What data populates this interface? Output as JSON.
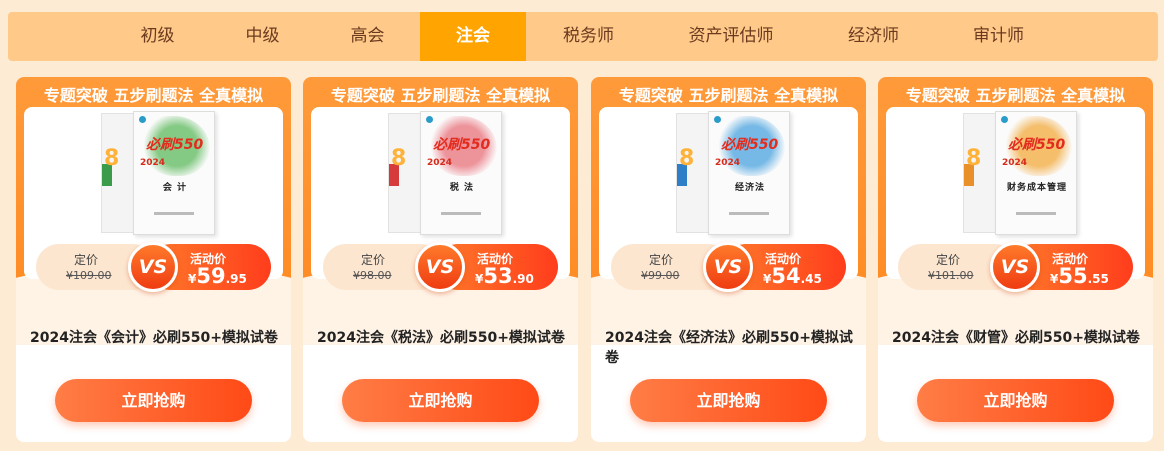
{
  "tabs": [
    {
      "label": "初级",
      "active": false
    },
    {
      "label": "中级",
      "active": false
    },
    {
      "label": "高会",
      "active": false
    },
    {
      "label": "注会",
      "active": true
    },
    {
      "label": "税务师",
      "active": false
    },
    {
      "label": "资产评估师",
      "active": false
    },
    {
      "label": "经济师",
      "active": false
    },
    {
      "label": "审计师",
      "active": false
    }
  ],
  "cards": [
    {
      "slogan": "专题突破 五步刷题法 全真模拟",
      "book_subject": "会 计",
      "book_series": "必刷550",
      "book_year": "2024",
      "book_color": "#5cb85c",
      "orig_label": "定价",
      "orig_price": "¥109.00",
      "vs": "VS",
      "sale_label": "活动价",
      "sale_currency": "¥",
      "sale_int": "59",
      "sale_dec": ".95",
      "title": "2024注会《会计》必刷550+模拟试卷",
      "buy_label": "立即抢购"
    },
    {
      "slogan": "专题突破 五步刷题法 全真模拟",
      "book_subject": "税 法",
      "book_series": "必刷550",
      "book_year": "2024",
      "book_color": "#e8707a",
      "orig_label": "定价",
      "orig_price": "¥98.00",
      "vs": "VS",
      "sale_label": "活动价",
      "sale_currency": "¥",
      "sale_int": "53",
      "sale_dec": ".90",
      "title": "2024注会《税法》必刷550+模拟试卷",
      "buy_label": "立即抢购"
    },
    {
      "slogan": "专题突破 五步刷题法 全真模拟",
      "book_subject": "经济法",
      "book_series": "必刷550",
      "book_year": "2024",
      "book_color": "#4aa3df",
      "orig_label": "定价",
      "orig_price": "¥99.00",
      "vs": "VS",
      "sale_label": "活动价",
      "sale_currency": "¥",
      "sale_int": "54",
      "sale_dec": ".45",
      "title": "2024注会《经济法》必刷550+模拟试卷",
      "buy_label": "立即抢购"
    },
    {
      "slogan": "专题突破 五步刷题法 全真模拟",
      "book_subject": "财务成本管理",
      "book_series": "必刷550",
      "book_year": "2024",
      "book_color": "#f2a93b",
      "orig_label": "定价",
      "orig_price": "¥101.00",
      "vs": "VS",
      "sale_label": "活动价",
      "sale_currency": "¥",
      "sale_int": "55",
      "sale_dec": ".55",
      "title": "2024注会《财管》必刷550+模拟试卷",
      "buy_label": "立即抢购"
    }
  ]
}
